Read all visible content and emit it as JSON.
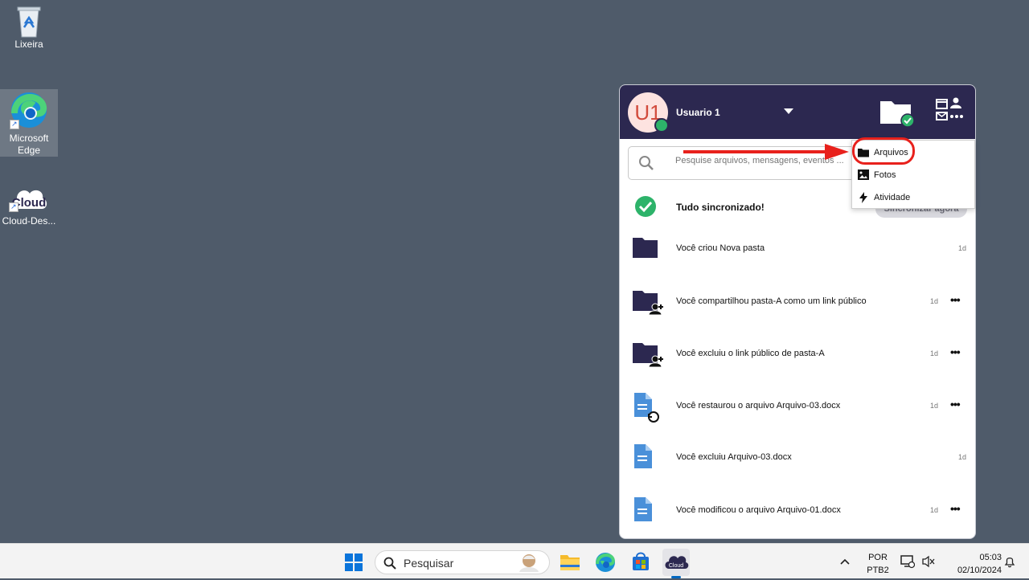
{
  "desktop": {
    "icons": [
      {
        "label": "Lixeira",
        "icon": "recycle-bin-icon"
      },
      {
        "label": "Microsoft Edge",
        "icon": "edge-icon"
      },
      {
        "label": "Cloud-Des...",
        "icon": "cloud-icon"
      }
    ]
  },
  "panel": {
    "user": {
      "initials": "U1",
      "name": "Usuario 1"
    },
    "search": {
      "placeholder": "Pesquise arquivos, mensagens, eventos ..."
    },
    "sync": {
      "text": "Tudo sincronizado!",
      "button": "Sincronizar agora"
    },
    "activities": [
      {
        "text": "Você criou Nova pasta",
        "time": "1d",
        "icon": "folder-icon",
        "more": false
      },
      {
        "text": "Você compartilhou pasta-A como um link público",
        "time": "1d",
        "icon": "folder-share-icon",
        "more": true
      },
      {
        "text": "Você excluiu o link público de pasta-A",
        "time": "1d",
        "icon": "folder-share-icon",
        "more": true
      },
      {
        "text": "Você restaurou o arquivo Arquivo-03.docx",
        "time": "1d",
        "icon": "file-restore-icon",
        "more": true
      },
      {
        "text": "Você excluiu Arquivo-03.docx",
        "time": "1d",
        "icon": "file-icon",
        "more": false
      },
      {
        "text": "Você modificou o arquivo Arquivo-01.docx",
        "time": "1d",
        "icon": "file-icon",
        "more": true
      }
    ],
    "more_label": "•••"
  },
  "menu": {
    "items": [
      {
        "label": "Arquivos",
        "icon": "folder-icon"
      },
      {
        "label": "Fotos",
        "icon": "image-icon"
      },
      {
        "label": "Atividade",
        "icon": "bolt-icon"
      }
    ]
  },
  "taskbar": {
    "search_label": "Pesquisar",
    "language": {
      "line1": "POR",
      "line2": "PTB2"
    },
    "clock": {
      "time": "05:03",
      "date": "02/10/2024"
    }
  },
  "colors": {
    "header": "#2c2850",
    "accent_red": "#e8211c",
    "file_blue": "#4a90d9",
    "sync_green": "#2db36a"
  }
}
